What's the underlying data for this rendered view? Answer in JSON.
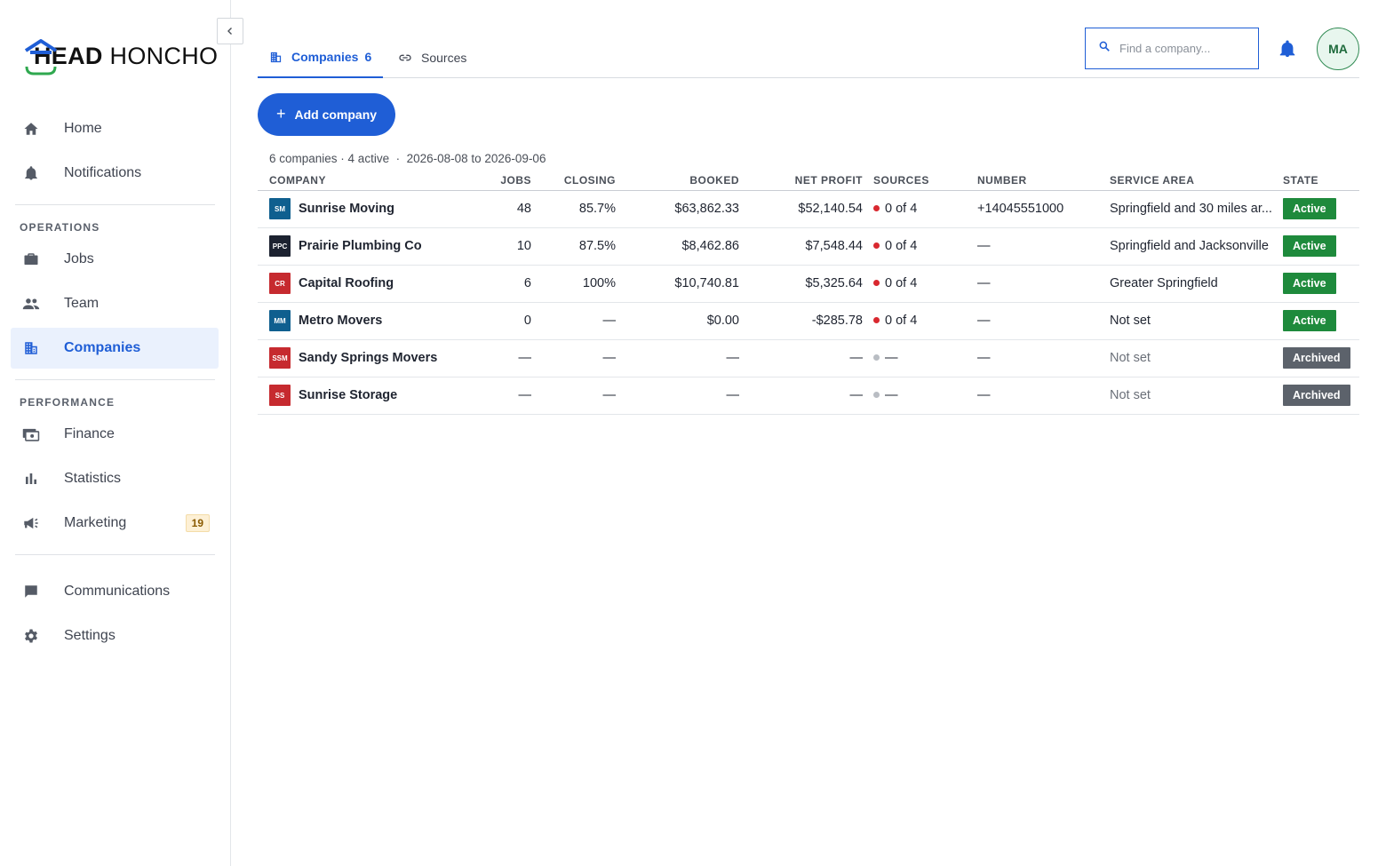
{
  "brand": {
    "name_bold": "HEAD",
    "name_rest": " HONCHO"
  },
  "sidebar": {
    "top_items": [
      {
        "label": "Home",
        "icon": "home-icon"
      },
      {
        "label": "Notifications",
        "icon": "bell-icon"
      }
    ],
    "sections": [
      {
        "title": "OPERATIONS",
        "items": [
          {
            "label": "Jobs",
            "icon": "briefcase-icon"
          },
          {
            "label": "Team",
            "icon": "people-icon"
          },
          {
            "label": "Companies",
            "icon": "building-icon",
            "active": true
          }
        ]
      },
      {
        "title": "PERFORMANCE",
        "items": [
          {
            "label": "Finance",
            "icon": "money-icon"
          },
          {
            "label": "Statistics",
            "icon": "bar-chart-icon"
          },
          {
            "label": "Marketing",
            "icon": "megaphone-icon",
            "badge": "19"
          }
        ]
      }
    ],
    "bottom_items": [
      {
        "label": "Communications",
        "icon": "chat-icon"
      },
      {
        "label": "Settings",
        "icon": "gear-icon"
      }
    ]
  },
  "tabs": [
    {
      "label": "Companies",
      "count": "6",
      "active": true
    },
    {
      "label": "Sources",
      "count": ""
    }
  ],
  "search": {
    "placeholder": "Find a company..."
  },
  "user": {
    "initials": "MA"
  },
  "actions": {
    "add_company": "Add company"
  },
  "summary": {
    "companies": "6 companies",
    "active": "4 active",
    "range": "2026-08-08 to 2026-09-06"
  },
  "table": {
    "columns": [
      "COMPANY",
      "JOBS",
      "CLOSING",
      "BOOKED",
      "NET PROFIT",
      "SOURCES",
      "NUMBER",
      "SERVICE AREA",
      "STATE"
    ],
    "rows": [
      {
        "initials": "SM",
        "chip_color": "#0f5f8f",
        "name": "Sunrise Moving",
        "jobs": "48",
        "closing": "85.7%",
        "booked": "$63,862.33",
        "net_profit": "$52,140.54",
        "sources_dot": "#d9282f",
        "sources": "0 of 4",
        "number": "+14045551000",
        "service_area": "Springfield and 30 miles ar...",
        "state": "Active",
        "state_color": "#1e8a3c"
      },
      {
        "initials": "PPC",
        "chip_color": "#1c2230",
        "name": "Prairie Plumbing Co",
        "jobs": "10",
        "closing": "87.5%",
        "booked": "$8,462.86",
        "net_profit": "$7,548.44",
        "sources_dot": "#d9282f",
        "sources": "0 of 4",
        "number": "—",
        "service_area": "Springfield and Jacksonville",
        "state": "Active",
        "state_color": "#1e8a3c"
      },
      {
        "initials": "CR",
        "chip_color": "#c62a2f",
        "name": "Capital Roofing",
        "jobs": "6",
        "closing": "100%",
        "booked": "$10,740.81",
        "net_profit": "$5,325.64",
        "sources_dot": "#d9282f",
        "sources": "0 of 4",
        "number": "—",
        "service_area": "Greater Springfield",
        "state": "Active",
        "state_color": "#1e8a3c"
      },
      {
        "initials": "MM",
        "chip_color": "#0f5f8f",
        "name": "Metro Movers",
        "jobs": "0",
        "closing": "—",
        "booked": "$0.00",
        "net_profit": "-$285.78",
        "sources_dot": "#d9282f",
        "sources": "0 of 4",
        "number": "—",
        "service_area": "Not set",
        "state": "Active",
        "state_color": "#1e8a3c"
      },
      {
        "initials": "SSM",
        "chip_color": "#c62a2f",
        "name": "Sandy Springs Movers",
        "jobs": "—",
        "closing": "—",
        "booked": "—",
        "net_profit": "—",
        "sources_dot": "#b9bdc3",
        "sources": "—",
        "number": "—",
        "service_area": "Not set",
        "state": "Archived",
        "state_color": "#5c626b"
      },
      {
        "initials": "SS",
        "chip_color": "#c62a2f",
        "name": "Sunrise Storage",
        "jobs": "—",
        "closing": "—",
        "booked": "—",
        "net_profit": "—",
        "sources_dot": "#b9bdc3",
        "sources": "—",
        "number": "—",
        "service_area": "Not set",
        "state": "Archived",
        "state_color": "#5c626b"
      }
    ]
  }
}
